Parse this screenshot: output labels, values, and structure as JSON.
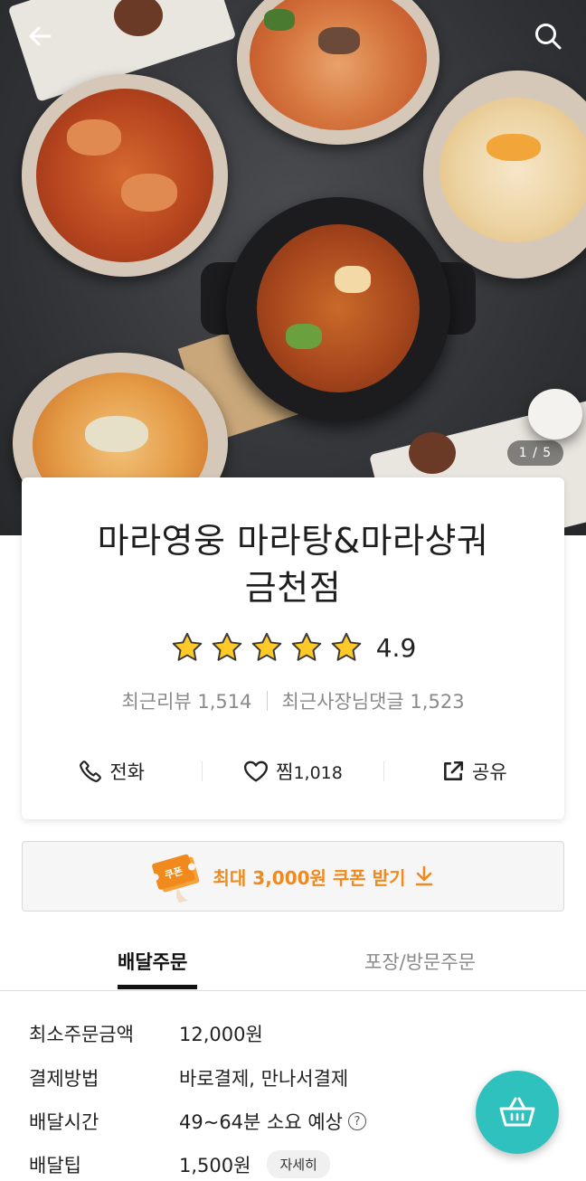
{
  "hero": {
    "page_indicator": "1 / 5"
  },
  "store": {
    "name_line1": "마라영웅 마라탕&마라샹궈",
    "name_line2": "금천점",
    "rating": "4.9",
    "star_count": 5,
    "recent_reviews": "최근리뷰 1,514",
    "recent_owner_replies": "최근사장님댓글 1,523"
  },
  "actions": {
    "call": "전화",
    "like": "찜",
    "like_count": "1,018",
    "share": "공유"
  },
  "coupon": {
    "badge": "쿠폰",
    "text": "최대 3,000원 쿠폰 받기"
  },
  "tabs": {
    "delivery": "배달주문",
    "takeout": "포장/방문주문"
  },
  "details": {
    "min_order_label": "최소주문금액",
    "min_order_value": "12,000원",
    "payment_label": "결제방법",
    "payment_value": "바로결제, 만나서결제",
    "time_label": "배달시간",
    "time_value": "49~64분 소요 예상",
    "tip_label": "배달팁",
    "tip_value": "1,500원",
    "tip_detail_button": "자세히"
  },
  "colors": {
    "accent_orange": "#f08a1c",
    "fab_teal": "#2fc1be",
    "star_yellow": "#ffc928"
  }
}
